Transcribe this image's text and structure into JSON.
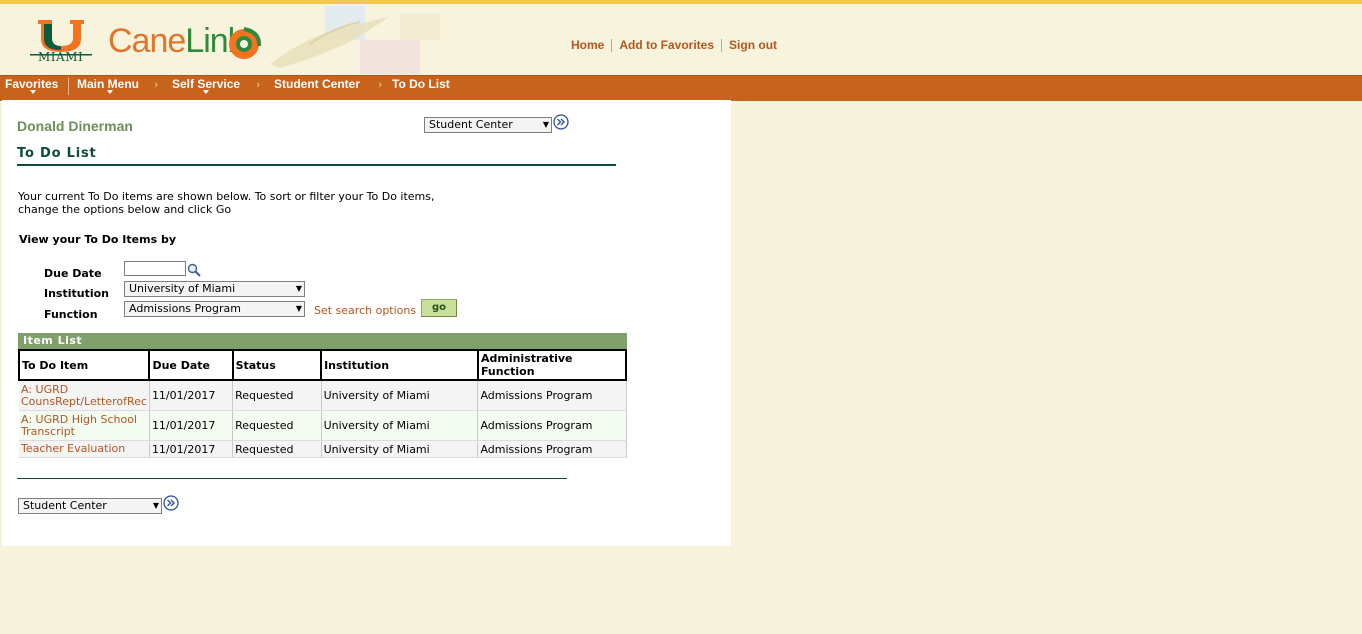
{
  "header": {
    "logo_text": "MIAMI",
    "brand_cane": "Cane",
    "brand_link": "Link",
    "links": [
      "Home",
      "Add to Favorites",
      "Sign out"
    ]
  },
  "nav": {
    "items": [
      "Favorites",
      "Main Menu",
      "Self Service",
      "Student Center",
      "To Do List"
    ],
    "separator": "›"
  },
  "user": {
    "name": "Donald Dinerman"
  },
  "top_select": {
    "value": "Student Center"
  },
  "page": {
    "title": "To Do List",
    "instructions": "Your current To Do items are shown below. To sort or filter your To Do items, change the options below and click Go",
    "view_by": "View your To Do Items by"
  },
  "filters": {
    "due_date_label": "Due Date",
    "due_date_value": "",
    "institution_label": "Institution",
    "institution_value": "University of Miami",
    "function_label": "Function",
    "function_value": "Admissions Program",
    "search_options": "Set search options",
    "go_label": "go"
  },
  "item_list": {
    "header": "Item List",
    "columns": [
      "To Do Item",
      "Due Date",
      "Status",
      "Institution",
      "Administrative Function"
    ],
    "rows": [
      [
        "A: UGRD CounsRept/LetterofRec",
        "11/01/2017",
        "Requested",
        "University of Miami",
        "Admissions Program"
      ],
      [
        "A: UGRD High School Transcript",
        "11/01/2017",
        "Requested",
        "University of Miami",
        "Admissions Program"
      ],
      [
        "Teacher Evaluation",
        "11/01/2017",
        "Requested",
        "University of Miami",
        "Admissions Program"
      ]
    ]
  },
  "bottom_select": {
    "value": "Student Center"
  },
  "colors": {
    "nav": "#c8631e",
    "accent_link": "#b4561f",
    "title": "#0b4d3a",
    "list_header": "#7fa06a"
  },
  "icons": [
    "u-logo-icon",
    "swirl-icon",
    "lookup-icon",
    "go-arrow-icon",
    "dropdown-arrow-icon"
  ]
}
